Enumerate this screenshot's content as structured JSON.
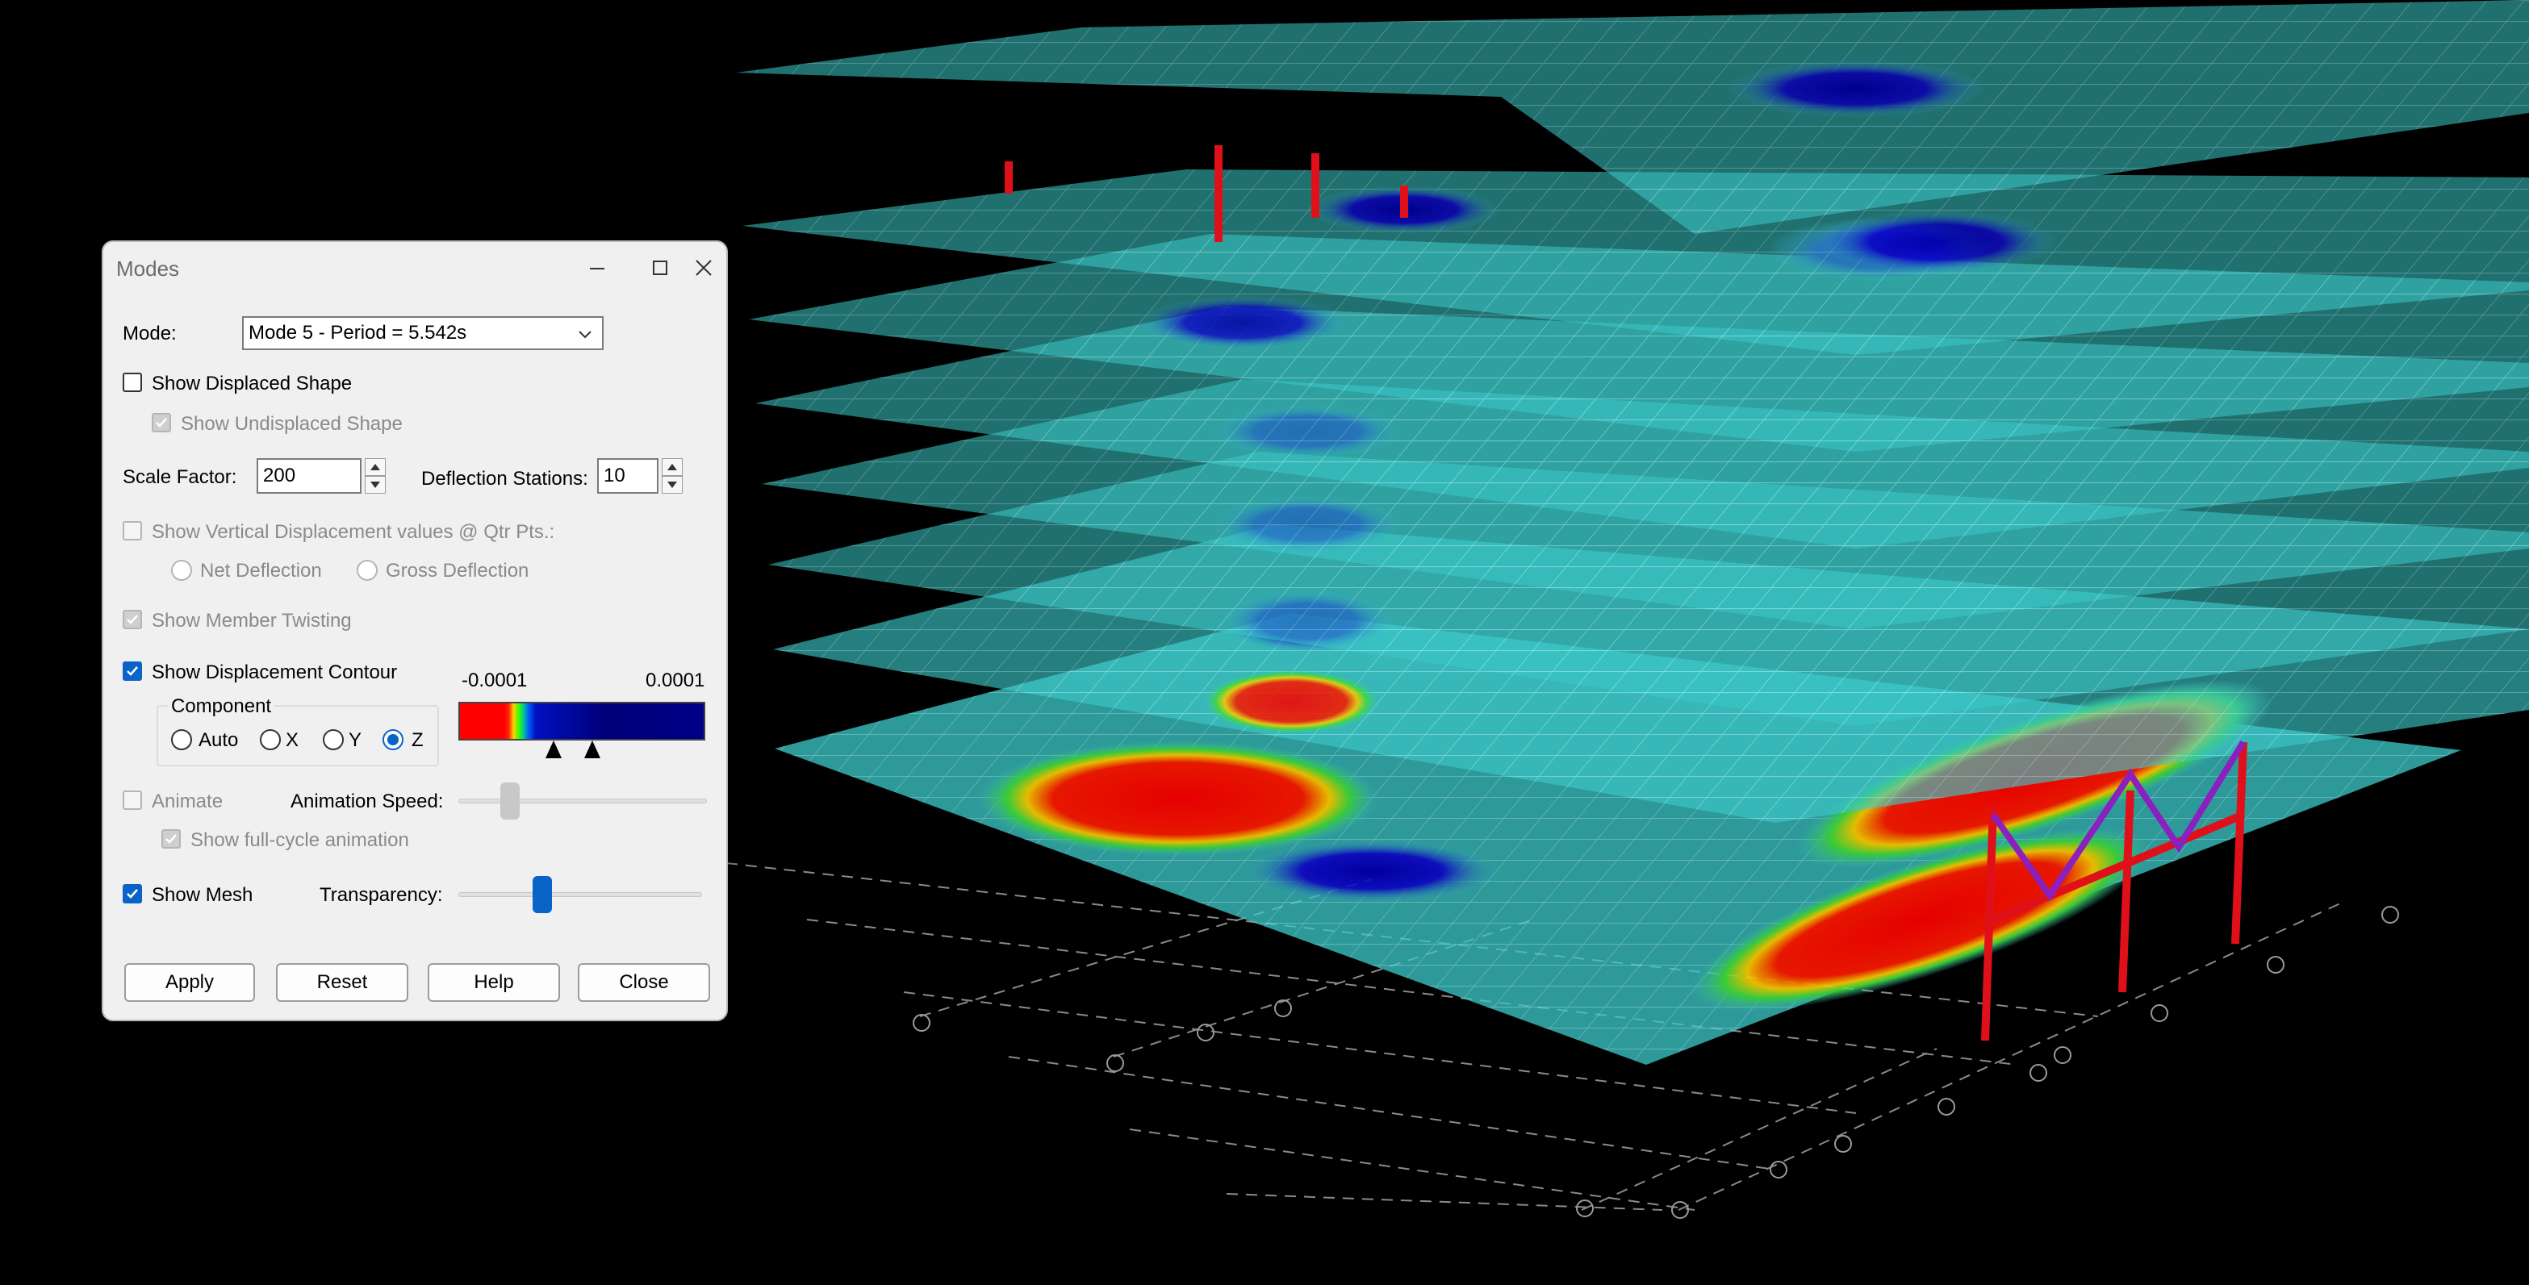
{
  "dialog": {
    "title": "Modes",
    "mode_label": "Mode:",
    "mode_value": "Mode 5 - Period = 5.542s",
    "show_displaced_shape": {
      "label": "Show Displaced Shape",
      "checked": false
    },
    "show_undisplaced_shape": {
      "label": "Show Undisplaced Shape",
      "checked": true,
      "enabled": false
    },
    "scale_factor": {
      "label": "Scale Factor:",
      "value": "200"
    },
    "deflection_stations": {
      "label": "Deflection Stations:",
      "value": "10"
    },
    "show_vertical_displacement": {
      "label": "Show Vertical Displacement values @ Qtr Pts.:",
      "checked": false,
      "enabled": false
    },
    "net_deflection_label": "Net Deflection",
    "gross_deflection_label": "Gross Deflection",
    "show_member_twisting": {
      "label": "Show Member Twisting",
      "checked": true,
      "enabled": false
    },
    "show_displacement_contour": {
      "label": "Show Displacement Contour",
      "checked": true
    },
    "component": {
      "label": "Component",
      "options": [
        "Auto",
        "X",
        "Y",
        "Z"
      ],
      "selected": "Z"
    },
    "contour_min": "-0.0001",
    "contour_max": "0.0001",
    "animate": {
      "label": "Animate",
      "checked": false,
      "enabled": false
    },
    "animation_speed_label": "Animation Speed:",
    "animation_speed_value": 0.2,
    "show_full_cycle": {
      "label": "Show full-cycle animation",
      "checked": true,
      "enabled": false
    },
    "show_mesh": {
      "label": "Show Mesh",
      "checked": true
    },
    "transparency_label": "Transparency:",
    "transparency_value": 0.34,
    "buttons": {
      "apply": "Apply",
      "reset": "Reset",
      "help": "Help",
      "close": "Close"
    }
  },
  "colors": {
    "accent": "#0a64c8",
    "mesh": "#40d0c8",
    "contour_high": "#ff0000",
    "contour_low": "#0000a0",
    "member": "#e0101a"
  }
}
